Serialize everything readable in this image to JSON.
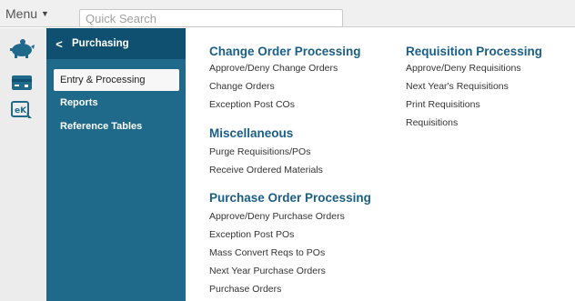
{
  "topbar": {
    "menu_label": "Menu",
    "search_placeholder": "Quick Search"
  },
  "rail": {
    "items": [
      {
        "icon": "piggy-bank-icon"
      },
      {
        "icon": "credit-card-icon"
      },
      {
        "icon": "ek-document-icon"
      }
    ]
  },
  "subnav": {
    "title": "Purchasing",
    "items": [
      {
        "label": "Entry & Processing"
      },
      {
        "label": "Reports"
      },
      {
        "label": "Reference Tables"
      }
    ]
  },
  "main": {
    "change_order": {
      "title": "Change Order Processing",
      "links": [
        "Approve/Deny Change Orders",
        "Change Orders",
        "Exception Post COs"
      ]
    },
    "misc": {
      "title": "Miscellaneous",
      "links": [
        "Purge Requisitions/POs",
        "Receive Ordered Materials"
      ]
    },
    "purchase_order": {
      "title": "Purchase Order Processing",
      "links": [
        "Approve/Deny Purchase Orders",
        "Exception Post POs",
        "Mass Convert Reqs to POs",
        "Next Year Purchase Orders",
        "Purchase Orders"
      ]
    },
    "requisition": {
      "title": "Requisition Processing",
      "links": [
        "Approve/Deny Requisitions",
        "Next Year's Requisitions",
        "Print Requisitions",
        "Requisitions"
      ]
    }
  },
  "colors": {
    "accent": "#1a5e86",
    "nav_bg": "#1f6a8a",
    "nav_head_bg": "#0f4f6f",
    "icon_blue": "#1f6a8a"
  }
}
